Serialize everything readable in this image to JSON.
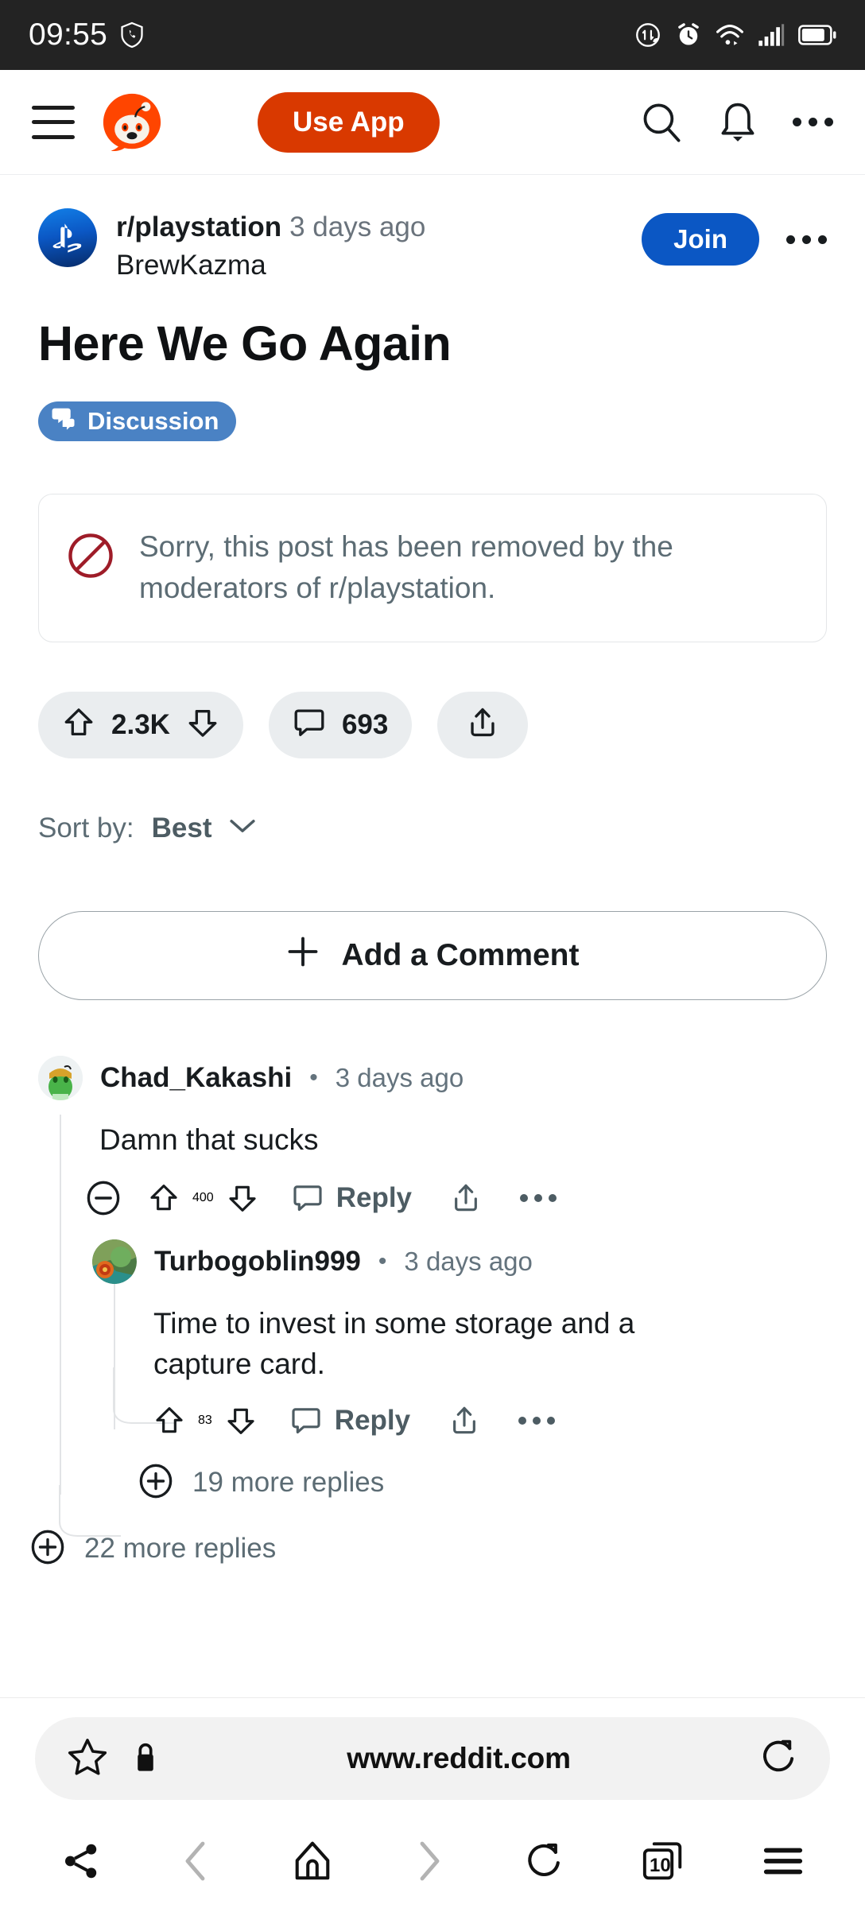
{
  "status_bar": {
    "time": "09:55",
    "left_icons": [
      "shield-phone-icon"
    ],
    "right_icons": [
      "data-saver-icon",
      "alarm-icon",
      "wifi-icon",
      "signal-icon",
      "battery-icon"
    ]
  },
  "header": {
    "menu_icon": "hamburger-icon",
    "logo": "reddit-logo",
    "use_app_label": "Use App",
    "icons": [
      "search-icon",
      "notification-bell-icon",
      "overflow-menu-icon"
    ]
  },
  "post": {
    "subreddit": "r/playstation",
    "age": "3 days ago",
    "author": "BrewKazma",
    "join_label": "Join",
    "title": "Here We Go Again",
    "flair": "Discussion",
    "removed_notice": "Sorry, this post has been removed by the moderators of r/playstation.",
    "vote_count": "2.3K",
    "comment_count": "693",
    "share_icon": "share-up-icon"
  },
  "sort": {
    "label": "Sort by:",
    "value": "Best"
  },
  "add_comment": {
    "label": "Add a Comment"
  },
  "comments": [
    {
      "user": "Chad_Kakashi",
      "age": "3 days ago",
      "body": "Damn that sucks",
      "score": "400",
      "reply_label": "Reply",
      "avatar_colors": [
        "#58c13c",
        "#eaa52a",
        "#2f7a25"
      ]
    },
    {
      "user": "Turbogoblin999",
      "age": "3 days ago",
      "body": "Time to invest in some storage and a capture card.",
      "score": "83",
      "reply_label": "Reply",
      "avatar_colors": [
        "#5d8f4e",
        "#2c8f8b",
        "#e06a1e"
      ]
    }
  ],
  "more_replies": [
    {
      "label": "19 more replies"
    },
    {
      "label": "22 more replies"
    }
  ],
  "browser": {
    "url": "www.reddit.com",
    "bookmark_icon": "star-icon",
    "lock_icon": "lock-icon",
    "reload_icon": "reload-icon",
    "nav": {
      "share": "share-icon",
      "back": "back-chevron-icon",
      "home": "home-icon",
      "forward": "forward-chevron-icon",
      "reload": "reload-icon",
      "tabs_count": "10",
      "menu": "menu-icon"
    }
  },
  "colors": {
    "reddit_orange": "#d93900",
    "join_blue": "#0b57c4",
    "flair_blue": "#4a82c4",
    "removed_red": "#9e1c28",
    "muted": "#5c6c74"
  }
}
